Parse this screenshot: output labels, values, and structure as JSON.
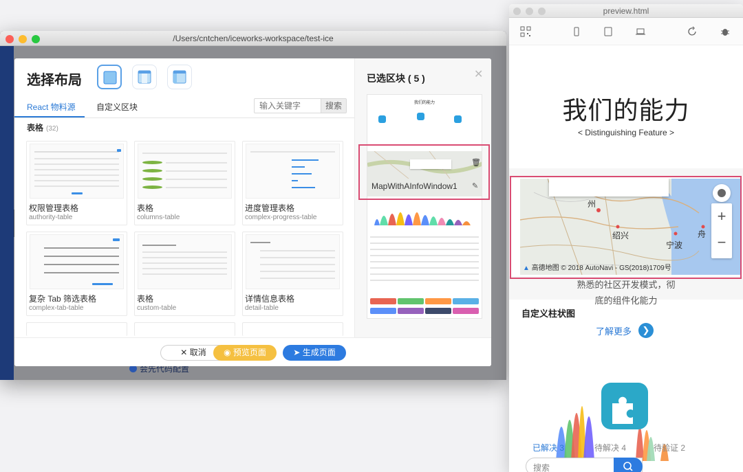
{
  "main_window": {
    "path": "/Users/cntchen/iceworks-workspace/test-ice",
    "bottom_text": "会先代码配置"
  },
  "modal": {
    "title": "选择布局",
    "tabs": [
      {
        "label": "React 物料源",
        "active": true
      },
      {
        "label": "自定义区块",
        "active": false
      }
    ],
    "search": {
      "placeholder": "输入关键字",
      "button": "搜索"
    },
    "section": {
      "title": "表格",
      "count": "(32)"
    },
    "cards": [
      {
        "name": "权限管理表格",
        "key": "authority-table"
      },
      {
        "name": "表格",
        "key": "columns-table"
      },
      {
        "name": "进度管理表格",
        "key": "complex-progress-table"
      },
      {
        "name": "复杂 Tab 筛选表格",
        "key": "complex-tab-table"
      },
      {
        "name": "表格",
        "key": "custom-table"
      },
      {
        "name": "详情信息表格",
        "key": "detail-table"
      }
    ],
    "selected": {
      "title": "已选区块 ( 5 )",
      "strip_heading": "我们的能力",
      "map_block": "MapWithAInfoWindow1"
    },
    "footer": {
      "cancel": "取消",
      "preview": "预览页面",
      "generate": "生成页面"
    }
  },
  "preview": {
    "window_title": "preview.html",
    "hero_title": "我们的能力",
    "hero_subtitle": "< Distinguishing Feature >",
    "map": {
      "cities": [
        "州",
        "绍兴",
        "宁波",
        "舟"
      ],
      "zoom_in": "+",
      "zoom_out": "−",
      "brand": "高德地图",
      "copyright": "© 2018 AutoNavi - GS(2018)1709号"
    },
    "body_lines": [
      "熟悉的社区开发模式，彻",
      "底的组件化能力"
    ],
    "chart_title": "自定义柱状图",
    "learn_more": "了解更多",
    "stats": [
      {
        "label": "已解决",
        "value": "3"
      },
      {
        "label": "待解决",
        "value": "4"
      },
      {
        "label": "待验证",
        "value": "2"
      }
    ],
    "search_placeholder": "搜索"
  },
  "colors": {
    "accent": "#2d7be0",
    "preview_button": "#f5c041",
    "highlight": "#d94b72",
    "sidebar": "#1d3a78"
  }
}
